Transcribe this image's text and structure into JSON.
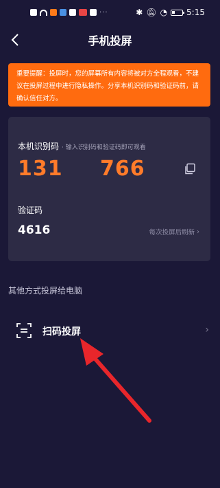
{
  "status_bar": {
    "time": "5:15",
    "dots": "···"
  },
  "header": {
    "back_icon": "‹",
    "title": "手机投屏"
  },
  "warning": {
    "text": "重要提醒：投屏时，您的屏幕所有内容将被对方全程观看，不建议在投屏过程中进行隐私操作。分享本机识别码和验证码前，请确认信任对方。"
  },
  "device_code": {
    "label": "本机识别码",
    "hint": "· 输入识别码和验证码即可观看",
    "part1": "131",
    "part2": "766",
    "copy_icon": "copy-icon"
  },
  "verification": {
    "label": "验证码",
    "code": "4616",
    "refresh_hint": "每次投屏后刷新",
    "chevron": "›"
  },
  "other_methods": {
    "label": "其他方式投屏给电脑",
    "scan_label": "扫码投屏",
    "scan_icon": "scan-icon",
    "chevron": "›"
  },
  "colors": {
    "background": "#1b1837",
    "card": "#2d2b45",
    "accent": "#ff7b2a",
    "warning": "#ff6b0f",
    "arrow": "#e8262b"
  }
}
